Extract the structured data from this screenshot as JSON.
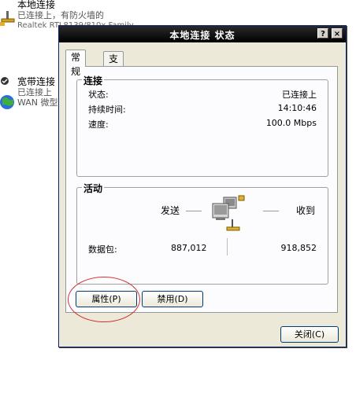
{
  "background_list": {
    "local": {
      "name": "本地连接",
      "status": "已连接上，有防火墙的",
      "device": "Realtek RTL8139/810x Family"
    },
    "broadband": {
      "name": "宽带连接",
      "status": "已连接上",
      "device": "WAN 微型"
    }
  },
  "window": {
    "title": "本地连接 状态",
    "help_label": "?",
    "close_label": "×"
  },
  "tabs": [
    {
      "label": "常规",
      "active": true
    },
    {
      "label": "支持",
      "active": false
    }
  ],
  "connection": {
    "legend": "连接",
    "status_label": "状态:",
    "status_value": "已连接上",
    "duration_label": "持续时间:",
    "duration_value": "14:10:46",
    "speed_label": "速度:",
    "speed_value": "100.0 Mbps"
  },
  "activity": {
    "legend": "活动",
    "sent_label": "发送",
    "received_label": "收到",
    "packets_label": "数据包:",
    "sent_value": "887,012",
    "received_value": "918,852"
  },
  "buttons": {
    "properties": "属性(P)",
    "disable": "禁用(D)",
    "close": "关闭(C)"
  },
  "colors": {
    "titlebar": "#000000",
    "annotation": "#d43030"
  }
}
